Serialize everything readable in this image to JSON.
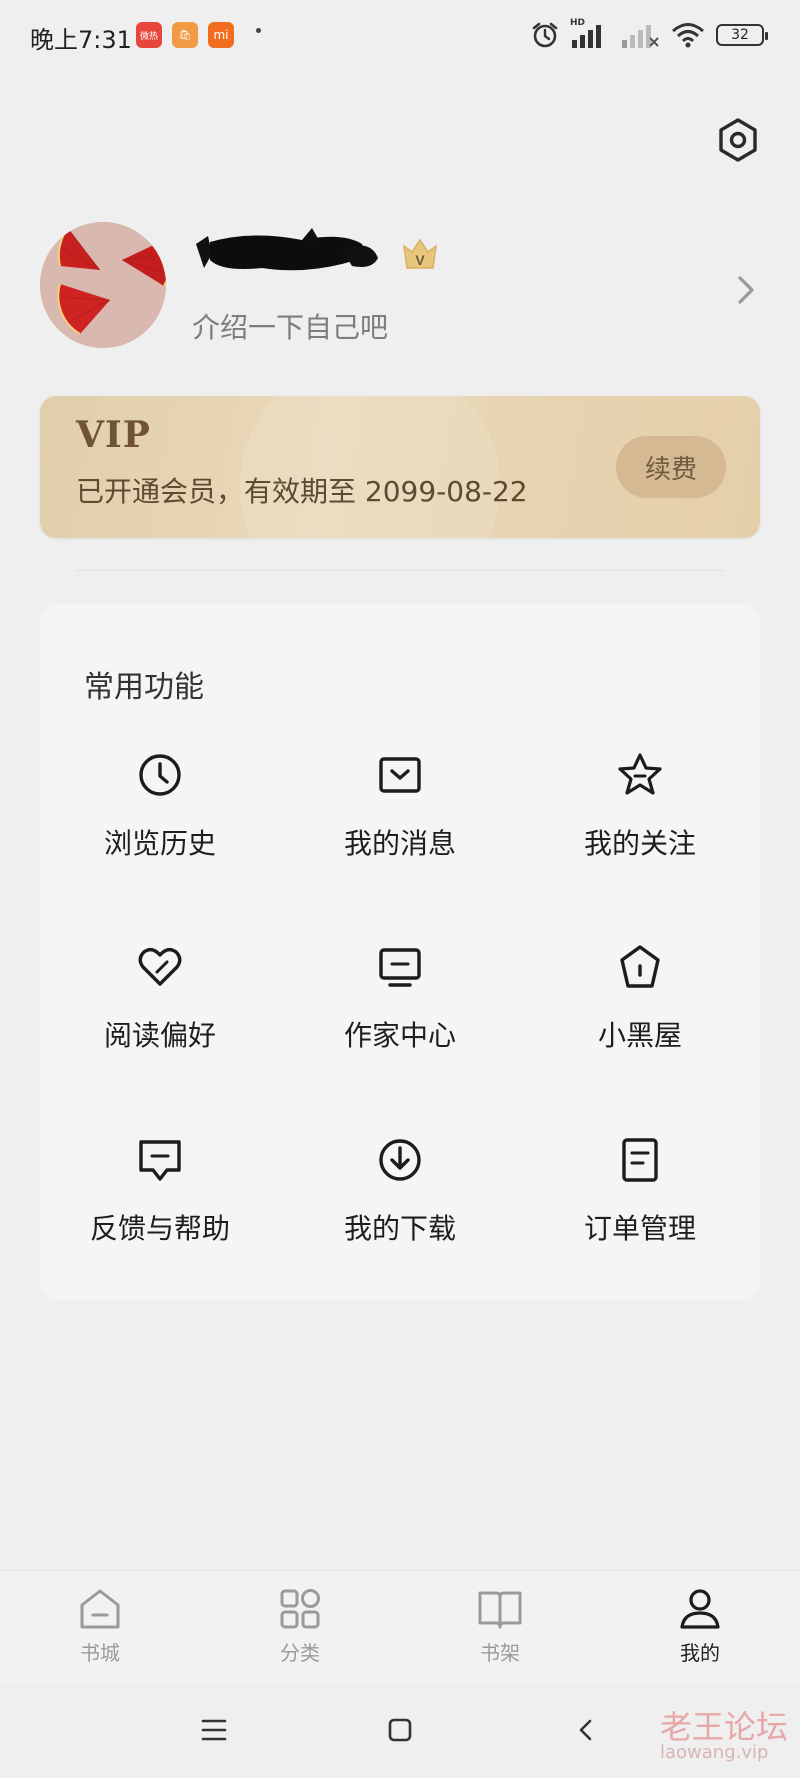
{
  "status_bar": {
    "time": "晚上7:31",
    "apps": [
      {
        "name": "weibo-badge",
        "text": "微热",
        "color": "#e8453c"
      },
      {
        "name": "shop-badge",
        "text": "🛍",
        "color": "#f39a45"
      },
      {
        "name": "mi-badge",
        "text": "mi",
        "color": "#f26d1f"
      }
    ],
    "hd_label": "HD",
    "battery": "32"
  },
  "header": {
    "settings_icon": "settings-hexagon-icon"
  },
  "profile": {
    "bio": "介绍一下自己吧",
    "vip_crown_icon": "crown-v-icon",
    "vip_crown_letter": "V"
  },
  "vip": {
    "title": "VIP",
    "description": "已开通会员，有效期至 2099-08-22",
    "renew_label": "续费"
  },
  "features": {
    "section_title": "常用功能",
    "items": [
      {
        "label": "浏览历史",
        "icon": "clock-icon"
      },
      {
        "label": "我的消息",
        "icon": "message-box-icon"
      },
      {
        "label": "我的关注",
        "icon": "star-icon"
      },
      {
        "label": "阅读偏好",
        "icon": "heart-icon"
      },
      {
        "label": "作家中心",
        "icon": "monitor-icon"
      },
      {
        "label": "小黑屋",
        "icon": "house-icon"
      },
      {
        "label": "反馈与帮助",
        "icon": "feedback-icon"
      },
      {
        "label": "我的下载",
        "icon": "download-icon"
      },
      {
        "label": "订单管理",
        "icon": "order-icon"
      }
    ]
  },
  "tabs": [
    {
      "label": "书城",
      "icon": "home-icon",
      "active": false
    },
    {
      "label": "分类",
      "icon": "grid-icon",
      "active": false
    },
    {
      "label": "书架",
      "icon": "book-icon",
      "active": false
    },
    {
      "label": "我的",
      "icon": "person-icon",
      "active": true
    }
  ],
  "watermark": {
    "text": "老王论坛",
    "url": "laowang.vip"
  }
}
